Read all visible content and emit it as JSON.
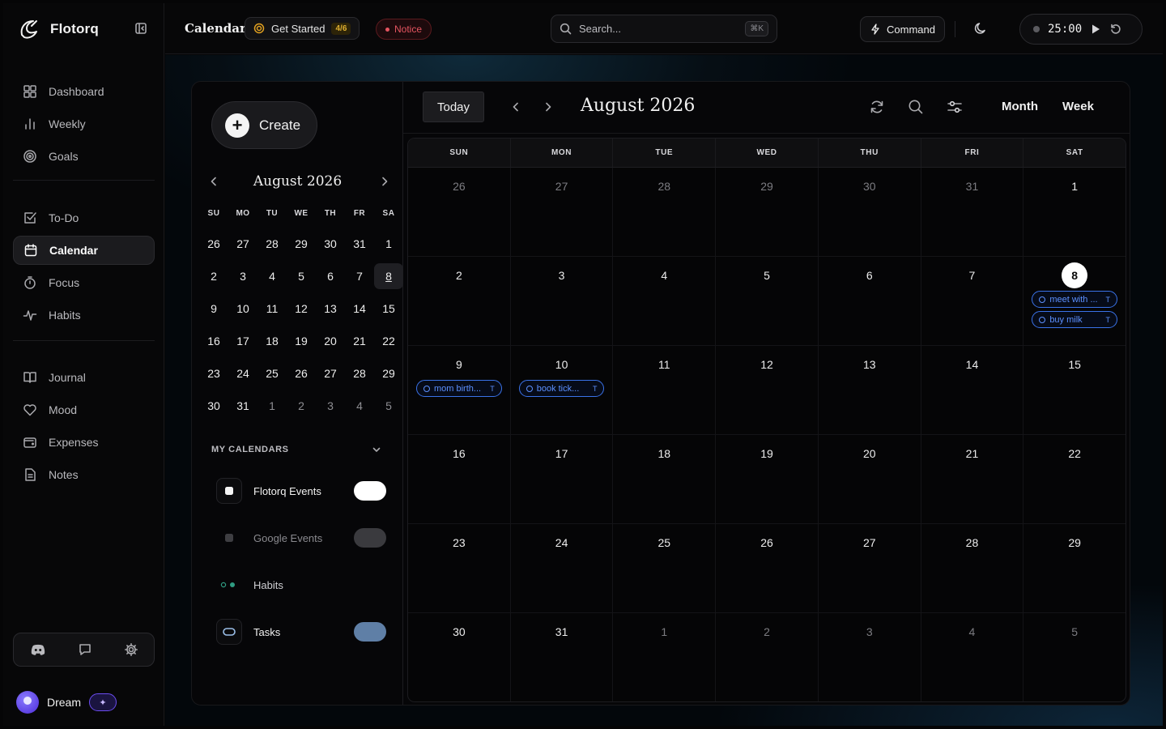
{
  "brand": {
    "name": "Flotorq"
  },
  "sidebar": {
    "groups": [
      [
        {
          "label": "Dashboard",
          "icon": "grid-icon"
        },
        {
          "label": "Weekly",
          "icon": "bar-chart-icon"
        },
        {
          "label": "Goals",
          "icon": "target-icon"
        }
      ],
      [
        {
          "label": "To-Do",
          "icon": "checkbox-icon"
        },
        {
          "label": "Calendar",
          "icon": "calendar-icon",
          "active": true
        },
        {
          "label": "Focus",
          "icon": "timer-icon"
        },
        {
          "label": "Habits",
          "icon": "pulse-icon"
        }
      ],
      [
        {
          "label": "Journal",
          "icon": "book-icon"
        },
        {
          "label": "Mood",
          "icon": "heart-icon"
        },
        {
          "label": "Expenses",
          "icon": "wallet-icon"
        },
        {
          "label": "Notes",
          "icon": "note-icon"
        }
      ]
    ],
    "tools": [
      "discord-icon",
      "chat-icon",
      "gear-icon"
    ],
    "user": {
      "name": "Dream",
      "badge_icon": "sparkle-icon"
    }
  },
  "topbar": {
    "title": "Calendar",
    "get_started": {
      "label": "Get Started",
      "count": "4/6"
    },
    "notice": "Notice",
    "search": {
      "placeholder": "Search...",
      "shortcut": "⌘K"
    },
    "command": "Command",
    "timer": "25:00"
  },
  "create_label": "Create",
  "mini_calendar": {
    "month": "August 2026",
    "headers": [
      "SU",
      "MO",
      "TU",
      "WE",
      "TH",
      "FR",
      "SA"
    ],
    "weeks": [
      [
        {
          "d": "26",
          "dim": false
        },
        {
          "d": "27",
          "dim": false
        },
        {
          "d": "28",
          "dim": false
        },
        {
          "d": "29",
          "dim": false
        },
        {
          "d": "30",
          "dim": false
        },
        {
          "d": "31",
          "dim": false
        },
        {
          "d": "1",
          "dim": false
        }
      ],
      [
        {
          "d": "2"
        },
        {
          "d": "3"
        },
        {
          "d": "4"
        },
        {
          "d": "5"
        },
        {
          "d": "6"
        },
        {
          "d": "7"
        },
        {
          "d": "8",
          "selected": true
        }
      ],
      [
        {
          "d": "9"
        },
        {
          "d": "10"
        },
        {
          "d": "11"
        },
        {
          "d": "12"
        },
        {
          "d": "13"
        },
        {
          "d": "14"
        },
        {
          "d": "15"
        }
      ],
      [
        {
          "d": "16"
        },
        {
          "d": "17"
        },
        {
          "d": "18"
        },
        {
          "d": "19"
        },
        {
          "d": "20"
        },
        {
          "d": "21"
        },
        {
          "d": "22"
        }
      ],
      [
        {
          "d": "23"
        },
        {
          "d": "24"
        },
        {
          "d": "25"
        },
        {
          "d": "26"
        },
        {
          "d": "27"
        },
        {
          "d": "28"
        },
        {
          "d": "29"
        }
      ],
      [
        {
          "d": "30"
        },
        {
          "d": "31"
        },
        {
          "d": "1",
          "dim": true
        },
        {
          "d": "2",
          "dim": true
        },
        {
          "d": "3",
          "dim": true
        },
        {
          "d": "4",
          "dim": true
        },
        {
          "d": "5",
          "dim": true
        }
      ]
    ]
  },
  "my_calendars": {
    "label": "MY CALENDARS",
    "items": [
      {
        "name": "Flotorq Events",
        "enabled": true,
        "toggle_color": "#ffffff",
        "name_color": "#f2f2f2"
      },
      {
        "name": "Google Events",
        "enabled": false,
        "toggle_color": "#3a3a3e",
        "name_color": "#8a8a8f"
      },
      {
        "name": "Habits",
        "enabled": null,
        "name_color": "#cfcfd3"
      },
      {
        "name": "Tasks",
        "enabled": true,
        "toggle_color": "#5f7fa6",
        "name_color": "#f2f2f2"
      }
    ]
  },
  "main_calendar": {
    "today_label": "Today",
    "month": "August 2026",
    "views": [
      "Month",
      "Week"
    ],
    "dow": [
      "SUN",
      "MON",
      "TUE",
      "WED",
      "THU",
      "FRI",
      "SAT"
    ],
    "weeks": [
      [
        {
          "d": "26",
          "dim": true
        },
        {
          "d": "27",
          "dim": true
        },
        {
          "d": "28",
          "dim": true
        },
        {
          "d": "29",
          "dim": true
        },
        {
          "d": "30",
          "dim": true
        },
        {
          "d": "31",
          "dim": true
        },
        {
          "d": "1"
        }
      ],
      [
        {
          "d": "2"
        },
        {
          "d": "3"
        },
        {
          "d": "4"
        },
        {
          "d": "5"
        },
        {
          "d": "6"
        },
        {
          "d": "7"
        },
        {
          "d": "8",
          "today": true,
          "events": [
            {
              "title": "meet with ...",
              "tag": "T"
            },
            {
              "title": "buy milk",
              "tag": "T"
            }
          ]
        }
      ],
      [
        {
          "d": "9",
          "events": [
            {
              "title": "mom birth...",
              "tag": "T"
            }
          ]
        },
        {
          "d": "10",
          "events": [
            {
              "title": "book tick...",
              "tag": "T"
            }
          ]
        },
        {
          "d": "11"
        },
        {
          "d": "12"
        },
        {
          "d": "13"
        },
        {
          "d": "14"
        },
        {
          "d": "15"
        }
      ],
      [
        {
          "d": "16"
        },
        {
          "d": "17"
        },
        {
          "d": "18"
        },
        {
          "d": "19"
        },
        {
          "d": "20"
        },
        {
          "d": "21"
        },
        {
          "d": "22"
        }
      ],
      [
        {
          "d": "23"
        },
        {
          "d": "24"
        },
        {
          "d": "25"
        },
        {
          "d": "26"
        },
        {
          "d": "27"
        },
        {
          "d": "28"
        },
        {
          "d": "29"
        }
      ],
      [
        {
          "d": "30"
        },
        {
          "d": "31"
        },
        {
          "d": "1",
          "dim": true
        },
        {
          "d": "2",
          "dim": true
        },
        {
          "d": "3",
          "dim": true
        },
        {
          "d": "4",
          "dim": true
        },
        {
          "d": "5",
          "dim": true
        }
      ]
    ]
  },
  "colors": {
    "accent": "#3a72e8",
    "notice": "#e55460",
    "badge": "#e0b030"
  }
}
